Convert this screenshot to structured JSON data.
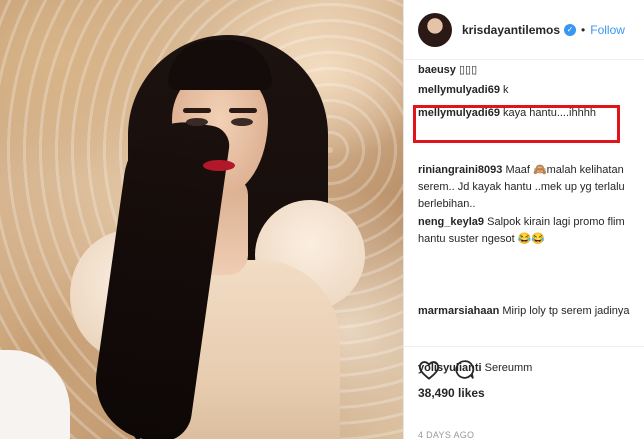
{
  "post": {
    "username": "krisdayantilemos",
    "follow_label": "Follow",
    "separator": "•",
    "verified_badge": "verified-check-icon",
    "likes": "38,490 likes",
    "timestamp": "4 DAYS AGO"
  },
  "comments": [
    {
      "user": "baeusy",
      "text": "▯▯▯"
    },
    {
      "user": "mellymulyadi69",
      "text": "k"
    },
    {
      "user": "mellymulyadi69",
      "text": "kaya hantu....ihhhh"
    },
    {
      "user": "riniangraini8093",
      "text": "Maaf 🙈malah kelihatan",
      "text2": "serem.. Jd kayak hantu ..mek up yg terlalu",
      "text3": "berlebihan.."
    },
    {
      "user": "neng_keyla9",
      "text": "Salpok kirain lagi promo flim",
      "text2": "hantu suster ngesot 😂😂"
    },
    {
      "user": "marmarsiahaan",
      "text": "Mirip loly tp serem jadinya"
    },
    {
      "user": "yolisyulianti",
      "text": "Sereumm"
    }
  ],
  "icons": {
    "like": "heart-icon",
    "comment": "comment-bubble-icon"
  },
  "colors": {
    "highlight_box": "#e2141b",
    "link_blue": "#3897f0",
    "text": "#262626"
  }
}
